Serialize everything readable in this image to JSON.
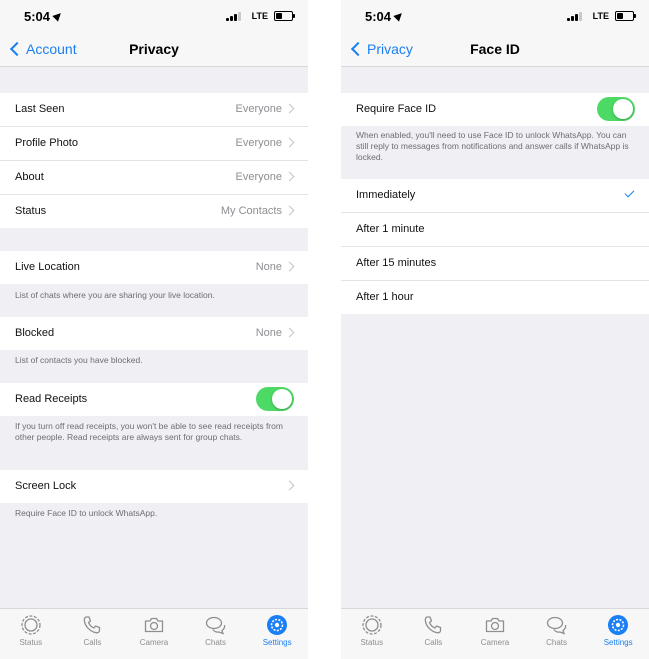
{
  "status": {
    "time": "5:04",
    "network": "LTE"
  },
  "colors": {
    "accent": "#1a7ff5",
    "toggle_on": "#4cd964",
    "background": "#efeff4"
  },
  "privacy": {
    "back_label": "Account",
    "title": "Privacy",
    "rows1": [
      {
        "label": "Last Seen",
        "value": "Everyone"
      },
      {
        "label": "Profile Photo",
        "value": "Everyone"
      },
      {
        "label": "About",
        "value": "Everyone"
      },
      {
        "label": "Status",
        "value": "My Contacts"
      }
    ],
    "live_location": {
      "label": "Live Location",
      "value": "None",
      "footer": "List of chats where you are sharing your live location."
    },
    "blocked": {
      "label": "Blocked",
      "value": "None",
      "footer": "List of contacts you have blocked."
    },
    "read_receipts": {
      "label": "Read Receipts",
      "enabled": true,
      "footer": "If you turn off read receipts, you won't be able to see read receipts from other people. Read receipts are always sent for group chats."
    },
    "screen_lock": {
      "label": "Screen Lock",
      "footer": "Require Face ID to unlock WhatsApp."
    }
  },
  "faceid": {
    "back_label": "Privacy",
    "title": "Face ID",
    "require": {
      "label": "Require Face ID",
      "enabled": true,
      "footer": "When enabled, you'll need to use Face ID to unlock WhatsApp. You can still reply to messages from notifications and answer calls if WhatsApp is locked."
    },
    "options": [
      {
        "label": "Immediately",
        "selected": true
      },
      {
        "label": "After 1 minute",
        "selected": false
      },
      {
        "label": "After 15 minutes",
        "selected": false
      },
      {
        "label": "After 1 hour",
        "selected": false
      }
    ]
  },
  "tabbar": [
    {
      "label": "Status",
      "icon": "status-icon",
      "active": false
    },
    {
      "label": "Calls",
      "icon": "phone-icon",
      "active": false
    },
    {
      "label": "Camera",
      "icon": "camera-icon",
      "active": false
    },
    {
      "label": "Chats",
      "icon": "chat-bubbles-icon",
      "active": false
    },
    {
      "label": "Settings",
      "icon": "gear-icon",
      "active": true
    }
  ]
}
